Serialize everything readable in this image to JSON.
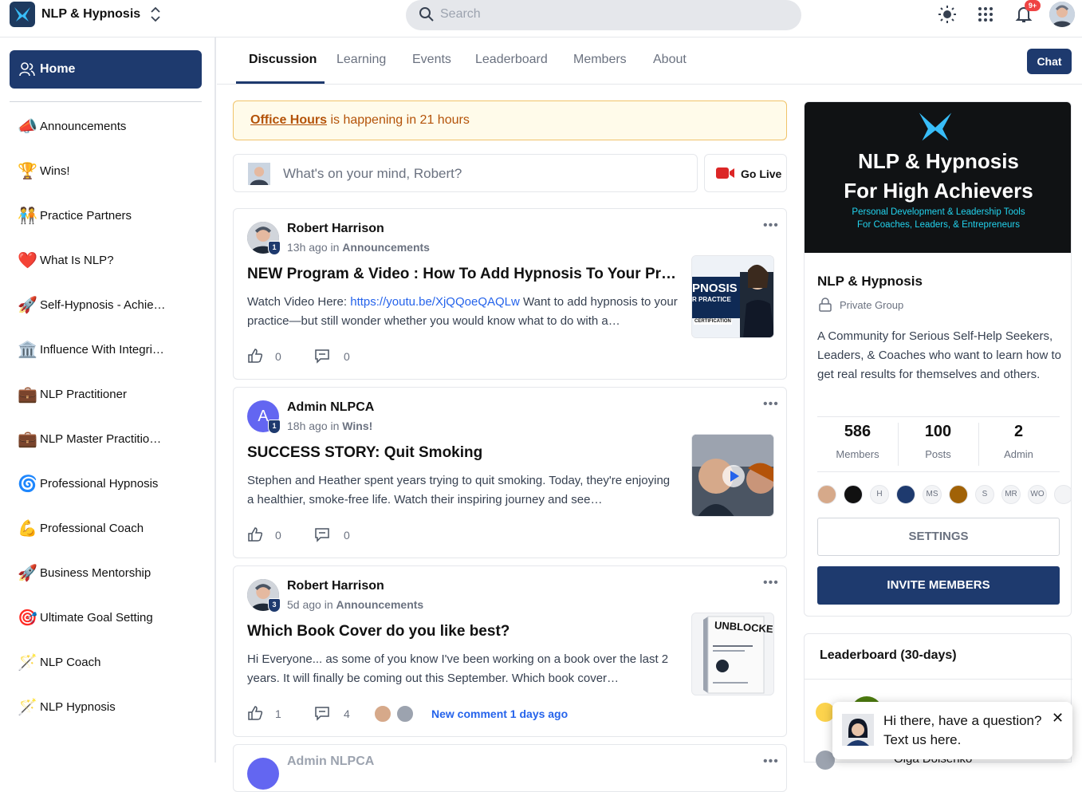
{
  "app": {
    "title": "NLP & Hypnosis"
  },
  "search": {
    "placeholder": "Search"
  },
  "notifications": {
    "badge": "9+"
  },
  "sidebar": {
    "home_label": "Home",
    "items": [
      {
        "label": "Announcements",
        "icon": "📣"
      },
      {
        "label": "Wins!",
        "icon": "🏆"
      },
      {
        "label": "Practice Partners",
        "icon": "🧑‍🤝‍🧑"
      },
      {
        "label": "What Is NLP?",
        "icon": "❤️"
      },
      {
        "label": "Self-Hypnosis - Achie…",
        "icon": "🚀"
      },
      {
        "label": "Influence With Integri…",
        "icon": "🏛️"
      },
      {
        "label": "NLP Practitioner",
        "icon": "💼"
      },
      {
        "label": "NLP Master Practitio…",
        "icon": "💼"
      },
      {
        "label": "Professional Hypnosis",
        "icon": "🌀"
      },
      {
        "label": "Professional Coach",
        "icon": "💪"
      },
      {
        "label": "Business Mentorship",
        "icon": "🚀"
      },
      {
        "label": "Ultimate Goal Setting",
        "icon": "🎯"
      },
      {
        "label": "NLP Coach",
        "icon": "🪄"
      },
      {
        "label": "NLP Hypnosis",
        "icon": "🪄"
      }
    ]
  },
  "tabs": [
    "Discussion",
    "Learning",
    "Events",
    "Leaderboard",
    "Members",
    "About"
  ],
  "chat_button": "Chat",
  "event_banner": {
    "event": "Office Hours",
    "text": " is happening in 21 hours"
  },
  "composer": {
    "placeholder": "What's on your mind, Robert?",
    "go_live": "Go Live"
  },
  "posts": [
    {
      "author": "Robert Harrison",
      "level": "1",
      "time": "13h ago",
      "in": "in",
      "category": "Announcements",
      "title": "NEW Program & Video : How To Add Hypnosis To Your Pra…",
      "body_prefix": "Watch Video Here: ",
      "link": "https://youtu.be/XjQQoeQAQLw",
      "body_suffix": " Want to add hypnosis to your practice—but still wonder whether you would know what to do with a…",
      "likes": "0",
      "comments": "0",
      "thumb_text": [
        "PNOSIS",
        "R PRACTICE",
        "CERTIFICATION"
      ]
    },
    {
      "author": "Admin NLPCA",
      "level": "1",
      "avatar_letter": "A",
      "time": "18h ago",
      "in": "in",
      "category": "Wins!",
      "title": "SUCCESS STORY: Quit Smoking",
      "body": "Stephen and Heather spent years trying to quit smoking. Today, they're enjoying a healthier, smoke-free life. Watch their inspiring journey and see…",
      "likes": "0",
      "comments": "0"
    },
    {
      "author": "Robert Harrison",
      "level": "3",
      "time": "5d ago",
      "in": "in",
      "category": "Announcements",
      "title": "Which Book Cover do you like best?",
      "body": "Hi Everyone... as some of you know I've been working on a book over the last 2 years. It will finally be coming out this September. Which book cover…",
      "likes": "1",
      "comments": "4",
      "new_comment": "New comment 1 days ago",
      "thumb_text": "UNBLOCKED"
    },
    {
      "author": "Admin NLPCA"
    }
  ],
  "group": {
    "banner_title_1": "NLP & Hypnosis",
    "banner_title_2": "For High Achievers",
    "banner_sub_1": "Personal Development & Leadership Tools",
    "banner_sub_2": "For Coaches, Leaders, & Entrepreneurs",
    "name": "NLP & Hypnosis",
    "type": "Private Group",
    "description": "A Community for Serious Self-Help Seekers, Leaders, & Coaches who want to learn how to get real results for themselves and others.",
    "stats": [
      {
        "value": "586",
        "label": "Members"
      },
      {
        "value": "100",
        "label": "Posts"
      },
      {
        "value": "2",
        "label": "Admin"
      }
    ],
    "member_initials": [
      "H",
      "MS",
      "S",
      "MR",
      "WO"
    ],
    "settings": "SETTINGS",
    "invite": "INVITE MEMBERS"
  },
  "leaderboard": {
    "title": "Leaderboard (30-days)",
    "partial_name": "Olga Dolsenko"
  },
  "chat_popup": {
    "text": "Hi there, have a question? Text us here."
  },
  "colors": {
    "primary": "#1e3a6e",
    "link": "#2563eb",
    "banner_accent": "#22d3ee",
    "event_text": "#b45309"
  }
}
